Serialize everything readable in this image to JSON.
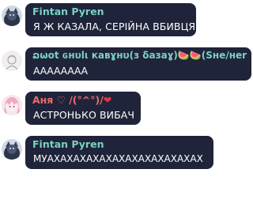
{
  "colors": {
    "bubble_bg": "#20243a",
    "name_teal": "#79d1c3",
    "name_pink": "#f06a6a",
    "message_text": "#ffffff",
    "heart": "#e8333d"
  },
  "messages": [
    {
      "author": "Fintan Pyren",
      "text": "Я Ж КАЗАЛА, СЕРІЙНА ВБИВЦЯ",
      "avatar": "dark-fox-avatar"
    },
    {
      "author": "ລωot ɢнυlι кaвɣнυ(з δaзaɣ)🍉🍉(Ѕнe/нer)...",
      "text": "АААААААА",
      "avatar": "pale-sketch-avatar"
    },
    {
      "author": "Аня ♡ /(°^°)/",
      "author_heart": "❤",
      "text": "АСТРОНЬКО ВИБАЧ",
      "avatar": "pink-anime-avatar"
    },
    {
      "author": "Fintan Pyren",
      "text": "МУАХАХАХАХАХАХАХАХАХАХАХАХ",
      "avatar": "dark-fox-avatar"
    }
  ]
}
